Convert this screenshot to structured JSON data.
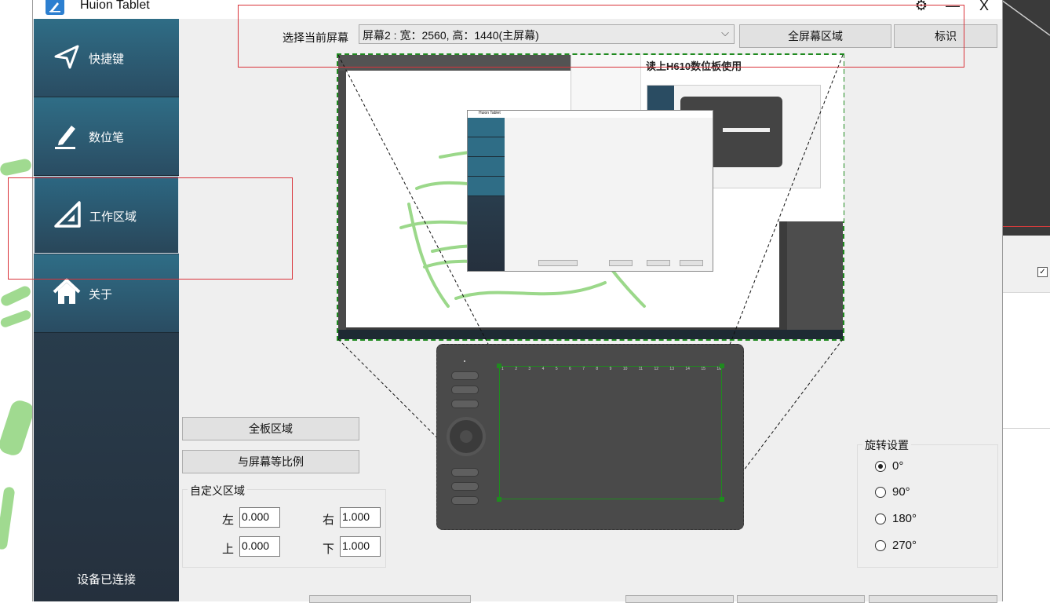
{
  "window": {
    "title": "Huion Tablet",
    "controls": {
      "settings": "⚙",
      "minimize": "—",
      "close": "X"
    }
  },
  "sidebar": {
    "items": [
      {
        "label": "快捷键",
        "icon": "send-icon"
      },
      {
        "label": "数位笔",
        "icon": "pen-icon"
      },
      {
        "label": "工作区域",
        "icon": "set-square-icon",
        "active": true
      },
      {
        "label": "关于",
        "icon": "home-icon"
      }
    ],
    "status": "设备已连接"
  },
  "screen_select": {
    "label": "选择当前屏幕",
    "value": "屏幕2 : 宽：2560, 高：1440(主屏幕)",
    "fullscreen_button": "全屏幕区域",
    "identify_button": "标识"
  },
  "area": {
    "full_tablet_button": "全板区域",
    "proportional_button": "与屏幕等比例",
    "custom_group_title": "自定义区域",
    "fields": {
      "left_label": "左",
      "left_value": "0.000",
      "right_label": "右",
      "right_value": "1.000",
      "top_label": "上",
      "top_value": "0.000",
      "bottom_label": "下",
      "bottom_value": "1.000"
    }
  },
  "rotation": {
    "title": "旋转设置",
    "options": [
      "0°",
      "90°",
      "180°",
      "270°"
    ],
    "selected": "0°"
  },
  "preview": {
    "inner_window_title": "Huion Tablet",
    "typora_heading": "读上H610数位板使用",
    "tablet_ruler": [
      "1",
      "2",
      "3",
      "4",
      "5",
      "6",
      "7",
      "8",
      "9",
      "10",
      "11",
      "12",
      "13",
      "14",
      "15",
      "16"
    ]
  },
  "colors": {
    "sidebar_top": "#2f6d86",
    "sidebar_bottom": "#25303d",
    "highlight_red": "#d9333a",
    "area_green": "#1f8a1f",
    "stroke_green": "#9bd88a"
  }
}
